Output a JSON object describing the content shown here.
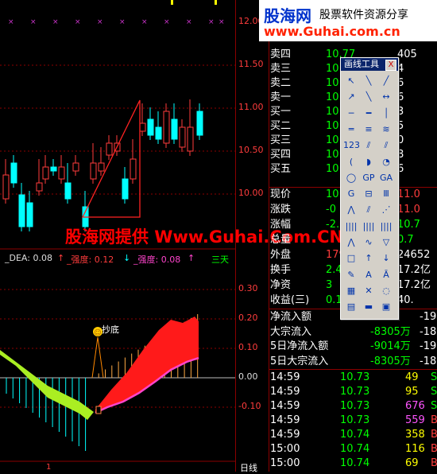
{
  "logo": {
    "cn_name": "股海网",
    "tagline": "股票软件资源分享",
    "url": "www.Guhai.com.cn"
  },
  "watermark": "股海网提供 Www.Guhai.Com.CN",
  "price_axis": [
    "11.50",
    "11.00",
    "10.50",
    "10.00"
  ],
  "indicator_axis": [
    "0.30",
    "0.20",
    "0.10",
    "0.00",
    "-0.10"
  ],
  "indicator_labels": {
    "dea": "_DEA: 0.08",
    "strength1": "_强度: 0.12",
    "strength2": "_强度: 0.08",
    "more": "三天"
  },
  "annotation": "抄底",
  "bottom_labels": {
    "period": "日线",
    "tick": "1"
  },
  "quote_rows": [
    {
      "label": "卖四",
      "v1": "10.77",
      "v2": "405"
    },
    {
      "label": "卖三",
      "v1": "10",
      "v2": "4"
    },
    {
      "label": "卖二",
      "v1": "10",
      "v2": "6"
    },
    {
      "label": "卖一",
      "v1": "10",
      "v2": "6"
    },
    {
      "label": "买一",
      "v1": "10",
      "v2": "3"
    },
    {
      "label": "买二",
      "v1": "10",
      "v2": "5"
    },
    {
      "label": "买三",
      "v1": "10",
      "v2": "0"
    },
    {
      "label": "买四",
      "v1": "10",
      "v2": "8"
    },
    {
      "label": "买五",
      "v1": "10",
      "v2": "6"
    }
  ],
  "quote_stats": [
    {
      "label": "现价",
      "v1": "10",
      "v2": "11.0"
    },
    {
      "label": "涨跌",
      "v1": "-0",
      "v2": "11.0"
    },
    {
      "label": "涨幅",
      "v1": "-2.5",
      "v2": "10.7"
    },
    {
      "label": "总量",
      "v1": "",
      "v2": "0.7"
    },
    {
      "label": "外盘",
      "v1": "1797",
      "v2": "24652"
    },
    {
      "label": "换手",
      "v1": "2.4",
      "v2": "17.2亿"
    },
    {
      "label": "净资",
      "v1": "3",
      "v2": "17.2亿"
    },
    {
      "label": "收益(三)",
      "v1": "0.1",
      "v2": "40."
    }
  ],
  "flow_rows": [
    {
      "label": "净流入额",
      "v1": "",
      "v2": "-19"
    },
    {
      "label": "大宗流入",
      "v1": "-8305万",
      "v2": "-18"
    },
    {
      "label": "5日净流入额",
      "v1": "-9014万",
      "v2": "-19"
    },
    {
      "label": "5日大宗流入",
      "v1": "-8305万",
      "v2": "-18"
    }
  ],
  "ticks": [
    {
      "time": "14:59",
      "price": "10.73",
      "vol": "49",
      "flag": "S",
      "color": "#ffff00"
    },
    {
      "time": "14:59",
      "price": "10.73",
      "vol": "95",
      "flag": "S",
      "color": "#ffff00"
    },
    {
      "time": "14:59",
      "price": "10.73",
      "vol": "676",
      "flag": "S",
      "color": "#ff55ff"
    },
    {
      "time": "14:59",
      "price": "10.73",
      "vol": "559",
      "flag": "B",
      "color": "#ff55ff"
    },
    {
      "time": "14:59",
      "price": "10.74",
      "vol": "358",
      "flag": "B",
      "color": "#ffff00"
    },
    {
      "time": "15:00",
      "price": "10.74",
      "vol": "116",
      "flag": "B",
      "color": "#ffff00"
    },
    {
      "time": "15:00",
      "price": "10.74",
      "vol": "69",
      "flag": "B",
      "color": "#ffff00"
    }
  ],
  "toolbox": {
    "title": "画线工具",
    "close_label": "X",
    "buttons": [
      {
        "icon": "pointer-icon",
        "glyph": "↖"
      },
      {
        "icon": "line-icon",
        "glyph": "╲"
      },
      {
        "icon": "ray-icon",
        "glyph": "╱"
      },
      {
        "icon": "arrow-line-icon",
        "glyph": "↗"
      },
      {
        "icon": "cross-line-icon",
        "glyph": "╲"
      },
      {
        "icon": "segment-icon",
        "glyph": "↔"
      },
      {
        "icon": "hline-icon",
        "glyph": "─"
      },
      {
        "icon": "hline2-icon",
        "glyph": "━"
      },
      {
        "icon": "vline-icon",
        "glyph": "│"
      },
      {
        "icon": "parallel-icon",
        "glyph": "═"
      },
      {
        "icon": "channel-icon",
        "glyph": "≡"
      },
      {
        "icon": "regression-icon",
        "glyph": "≋"
      },
      {
        "icon": "fibonacci-icon",
        "glyph": "123"
      },
      {
        "icon": "gann-icon",
        "glyph": "⫽"
      },
      {
        "icon": "trend-icon",
        "glyph": "⫽"
      },
      {
        "icon": "arc-icon",
        "glyph": "("
      },
      {
        "icon": "cycle-icon",
        "glyph": "◗"
      },
      {
        "icon": "clock-icon",
        "glyph": "◔"
      },
      {
        "icon": "ellipse-icon",
        "glyph": "◯"
      },
      {
        "icon": "gp-icon",
        "glyph": "GP"
      },
      {
        "icon": "ga-icon",
        "glyph": "GA"
      },
      {
        "icon": "golden-icon",
        "glyph": "G"
      },
      {
        "icon": "percent-icon",
        "glyph": "⊟"
      },
      {
        "icon": "period-icon",
        "glyph": "Ⅲ"
      },
      {
        "icon": "fan-icon",
        "glyph": "⋀"
      },
      {
        "icon": "fan2-icon",
        "glyph": "⫽"
      },
      {
        "icon": "fan3-icon",
        "glyph": "⋰"
      },
      {
        "icon": "bars-icon",
        "glyph": "||||"
      },
      {
        "icon": "bars2-icon",
        "glyph": "||||"
      },
      {
        "icon": "bars3-icon",
        "glyph": "||||"
      },
      {
        "icon": "polyline-icon",
        "glyph": "⋀"
      },
      {
        "icon": "wave-icon",
        "glyph": "∿"
      },
      {
        "icon": "triangle-icon",
        "glyph": "▽"
      },
      {
        "icon": "rectangle-icon",
        "glyph": "□"
      },
      {
        "icon": "up-arrow-icon",
        "glyph": "↑"
      },
      {
        "icon": "down-arrow-icon",
        "glyph": "↓"
      },
      {
        "icon": "pen-icon",
        "glyph": "✎"
      },
      {
        "icon": "text-icon",
        "glyph": "A"
      },
      {
        "icon": "text2-icon",
        "glyph": "Ā"
      },
      {
        "icon": "clear-icon",
        "glyph": "▦"
      },
      {
        "icon": "delete-icon",
        "glyph": "✕"
      },
      {
        "icon": "hide-icon",
        "glyph": "◌"
      },
      {
        "icon": "list-icon",
        "glyph": "▤"
      },
      {
        "icon": "ruler-icon",
        "glyph": "▬"
      },
      {
        "icon": "screen-icon",
        "glyph": "▣"
      }
    ]
  },
  "colors": {
    "up": "#ff3c3c",
    "down": "#00ffff",
    "grid": "#8b0000",
    "axis_red": "#ff3c3c",
    "lime": "#aaee22",
    "band_red": "#ff1a1a",
    "band_pink": "#ff44cc"
  }
}
